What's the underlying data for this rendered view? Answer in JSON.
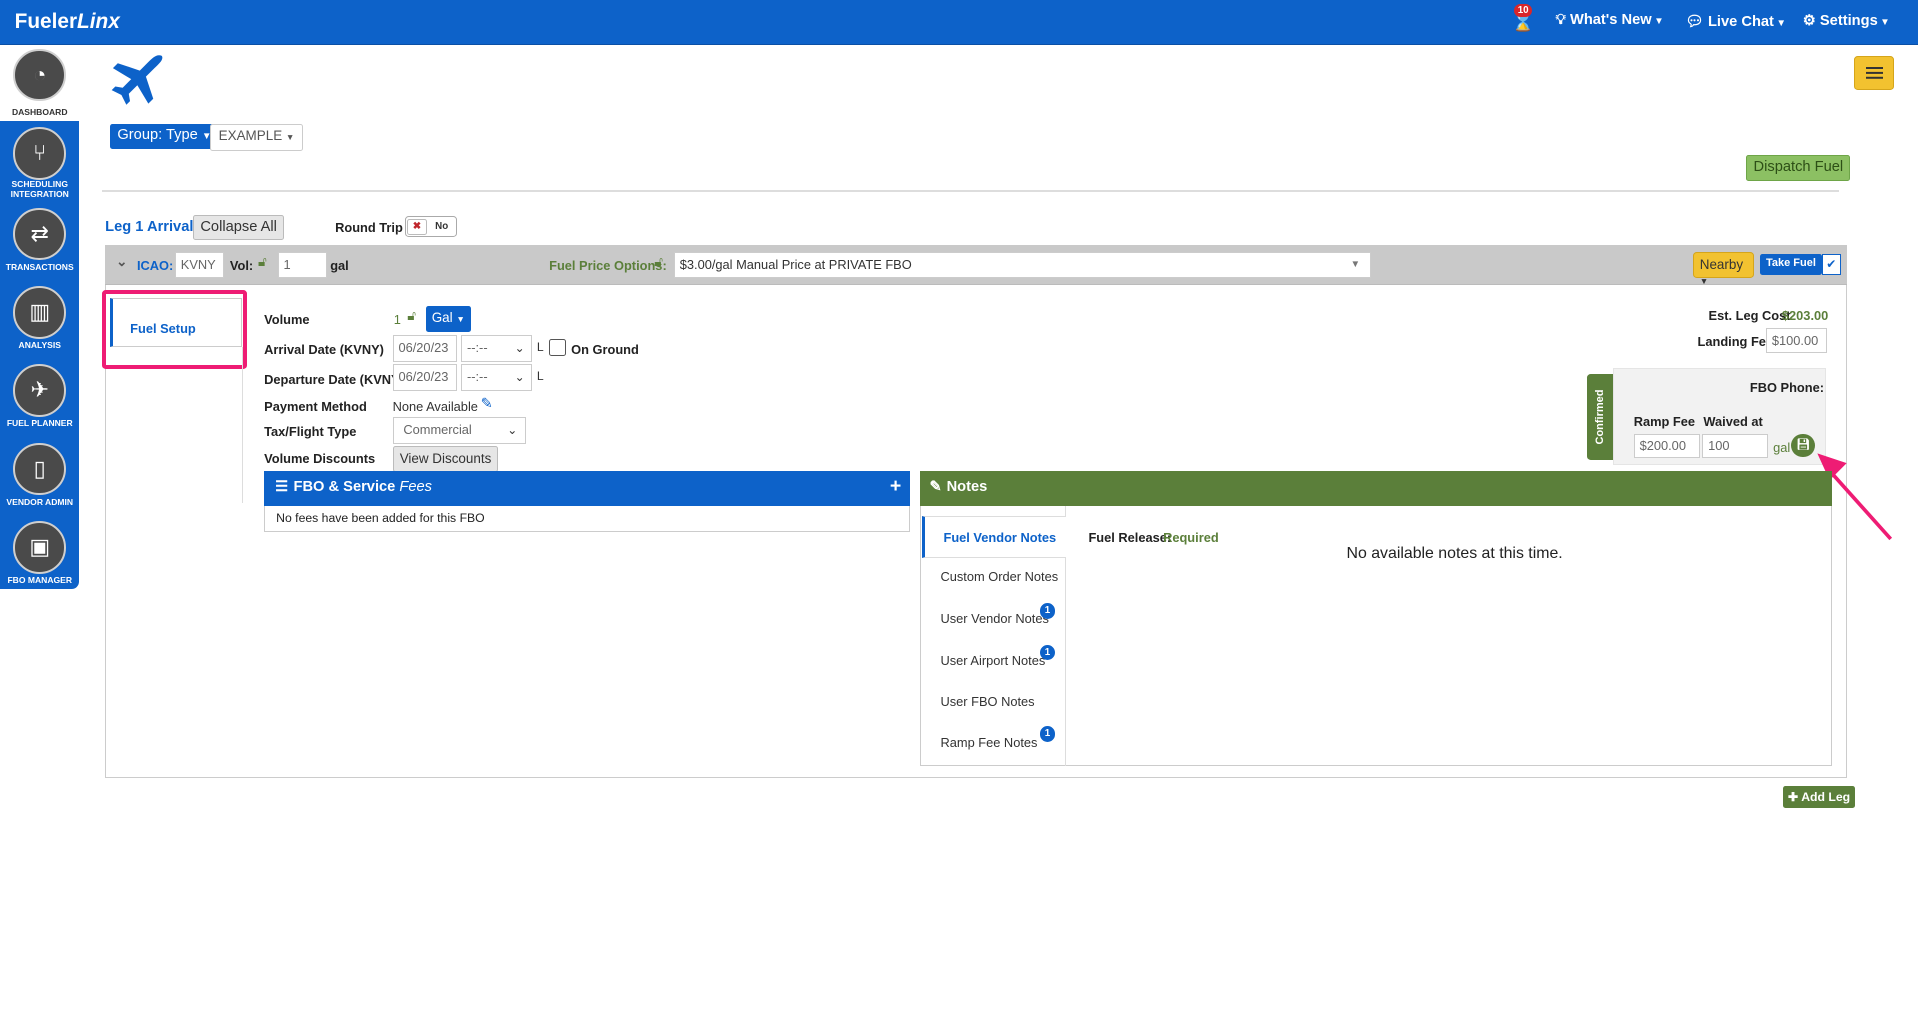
{
  "app": {
    "logo_main": "Fueler",
    "logo_italic": "Linx"
  },
  "topnav": {
    "notif_count": "10",
    "whats_new": "What's New",
    "live_chat": "Live Chat",
    "settings": "Settings"
  },
  "sidebar": [
    {
      "label": "DASHBOARD",
      "icon": "gauge-icon"
    },
    {
      "label": "SCHEDULING INTEGRATION",
      "icon": "fork-icon"
    },
    {
      "label": "TRANSACTIONS",
      "icon": "arrows-icon"
    },
    {
      "label": "ANALYSIS",
      "icon": "bar-chart-icon"
    },
    {
      "label": "FUEL PLANNER",
      "icon": "plane-icon"
    },
    {
      "label": "VENDOR ADMIN",
      "icon": "document-icon"
    },
    {
      "label": "FBO MANAGER",
      "icon": "clipboard-icon"
    }
  ],
  "toolbar": {
    "group_btn": "Group: Type",
    "example_btn": "EXAMPLE",
    "dispatch_btn": "Dispatch Fuel"
  },
  "leg": {
    "title": "Leg 1 Arrival",
    "collapse_all": "Collapse All",
    "round_trip_label": "Round Trip",
    "round_trip_value": "No",
    "icao_label": "ICAO:",
    "icao_value": "KVNY",
    "vol_label": "Vol:",
    "vol_value": "1",
    "vol_unit": "gal",
    "fuel_price_label": "Fuel Price Options:",
    "fuel_price_value": "$3.00/gal Manual Price at PRIVATE FBO",
    "nearby_btn": "Nearby",
    "take_fuel_btn": "Take Fuel"
  },
  "setup": {
    "tab_label": "Fuel Setup",
    "volume_label": "Volume",
    "volume_value": "1",
    "unit_btn": "Gal",
    "arrival_label": "Arrival Date (KVNY)",
    "arrival_date": "06/20/23",
    "arrival_time": "--:--",
    "time_suffix": "L",
    "on_ground_label": "On Ground",
    "departure_label": "Departure Date (KVNY)",
    "departure_date": "06/20/23",
    "departure_time": "--:--",
    "payment_label": "Payment Method",
    "payment_value": "None Available",
    "tax_label": "Tax/Flight Type",
    "tax_value": "Commercial",
    "discounts_label": "Volume Discounts",
    "discounts_btn": "View Discounts"
  },
  "costs": {
    "est_leg_cost_label": "Est. Leg Cost",
    "est_leg_cost_value": "$203.00",
    "landing_fee_label": "Landing Fee",
    "landing_fee_value": "$100.00",
    "confirmed_label": "Confirmed",
    "fbo_phone_label": "FBO Phone:",
    "ramp_fee_label": "Ramp Fee",
    "ramp_fee_value": "$200.00",
    "waived_label": "Waived at",
    "waived_value": "100",
    "waived_unit": "gal"
  },
  "fees": {
    "title": "FBO & Service",
    "title_italic": "Fees",
    "empty": "No fees have been added for this FBO"
  },
  "notes": {
    "title": "Notes",
    "tabs": [
      {
        "label": "Fuel Vendor Notes",
        "badge": ""
      },
      {
        "label": "Custom Order Notes",
        "badge": ""
      },
      {
        "label": "User Vendor Notes",
        "badge": "1"
      },
      {
        "label": "User Airport Notes",
        "badge": "1"
      },
      {
        "label": "User FBO Notes",
        "badge": ""
      },
      {
        "label": "Ramp Fee Notes",
        "badge": "1"
      }
    ],
    "fuel_release_label": "Fuel Release:",
    "fuel_release_value": "Required",
    "empty": "No available notes at this time."
  },
  "footer": {
    "add_leg": "Add Leg"
  },
  "colors": {
    "brand_blue": "#0d62c9",
    "green": "#5b7f3a",
    "highlight": "#ee1c74"
  }
}
